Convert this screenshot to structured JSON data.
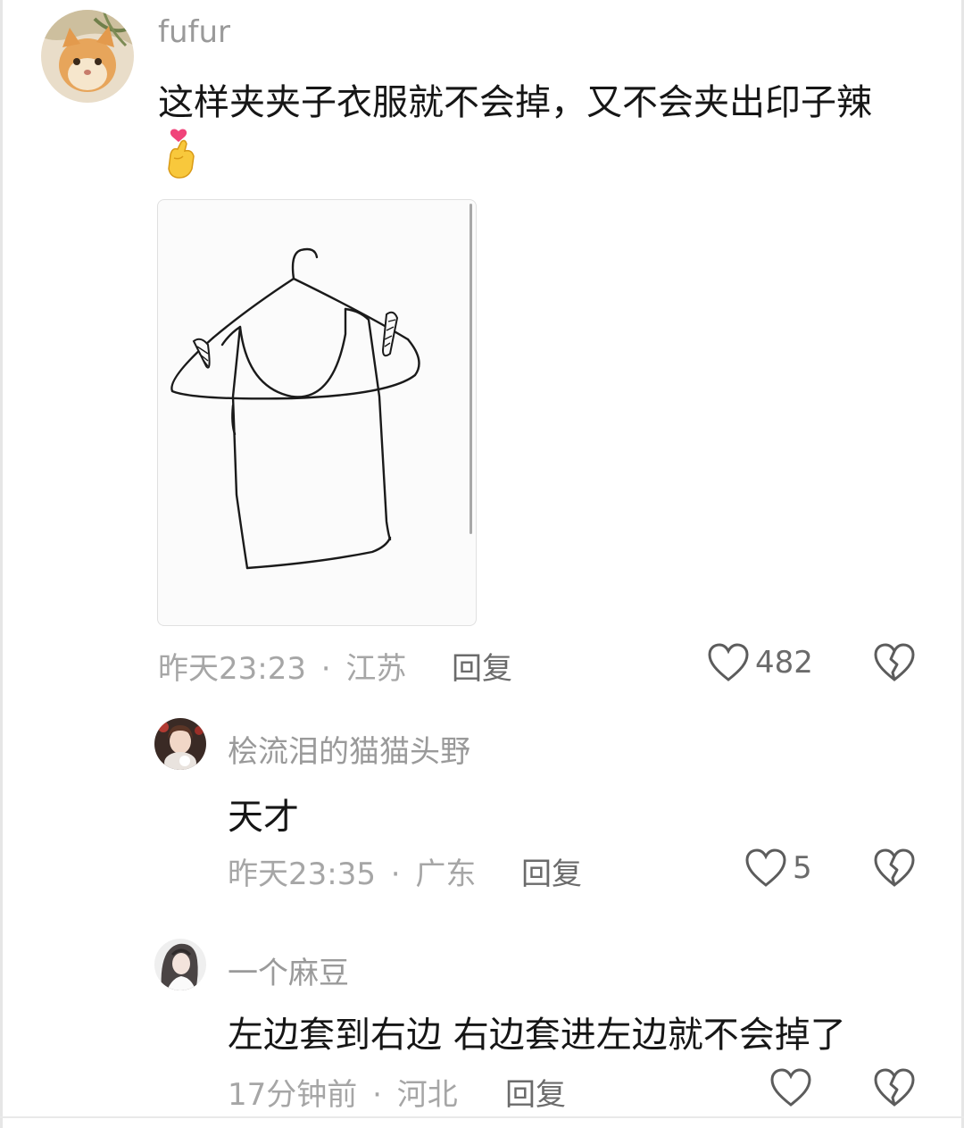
{
  "comments": [
    {
      "username": "fufur",
      "text_line1": "这样夹夹子衣服就不会掉，又不会夹出印子辣",
      "emoji": "heart-hands-emoji",
      "time": "昨天23:23",
      "location": "江苏",
      "reply_label": "回复",
      "likes": "482"
    },
    {
      "username": "桧流泪的猫猫头野",
      "text": "天才",
      "time": "昨天23:35",
      "location": "广东",
      "reply_label": "回复",
      "likes": "5"
    },
    {
      "username": "一个麻豆",
      "text": "左边套到右边 右边套进左边就不会掉了",
      "time": "17分钟前",
      "location": "河北",
      "reply_label": "回复",
      "likes": ""
    }
  ],
  "separator": "·",
  "colors": {
    "meta_gray": "#a6a6a6",
    "username_gray": "#9a9a9a",
    "text_black": "#161616",
    "heart_pink": "#f0437a"
  }
}
